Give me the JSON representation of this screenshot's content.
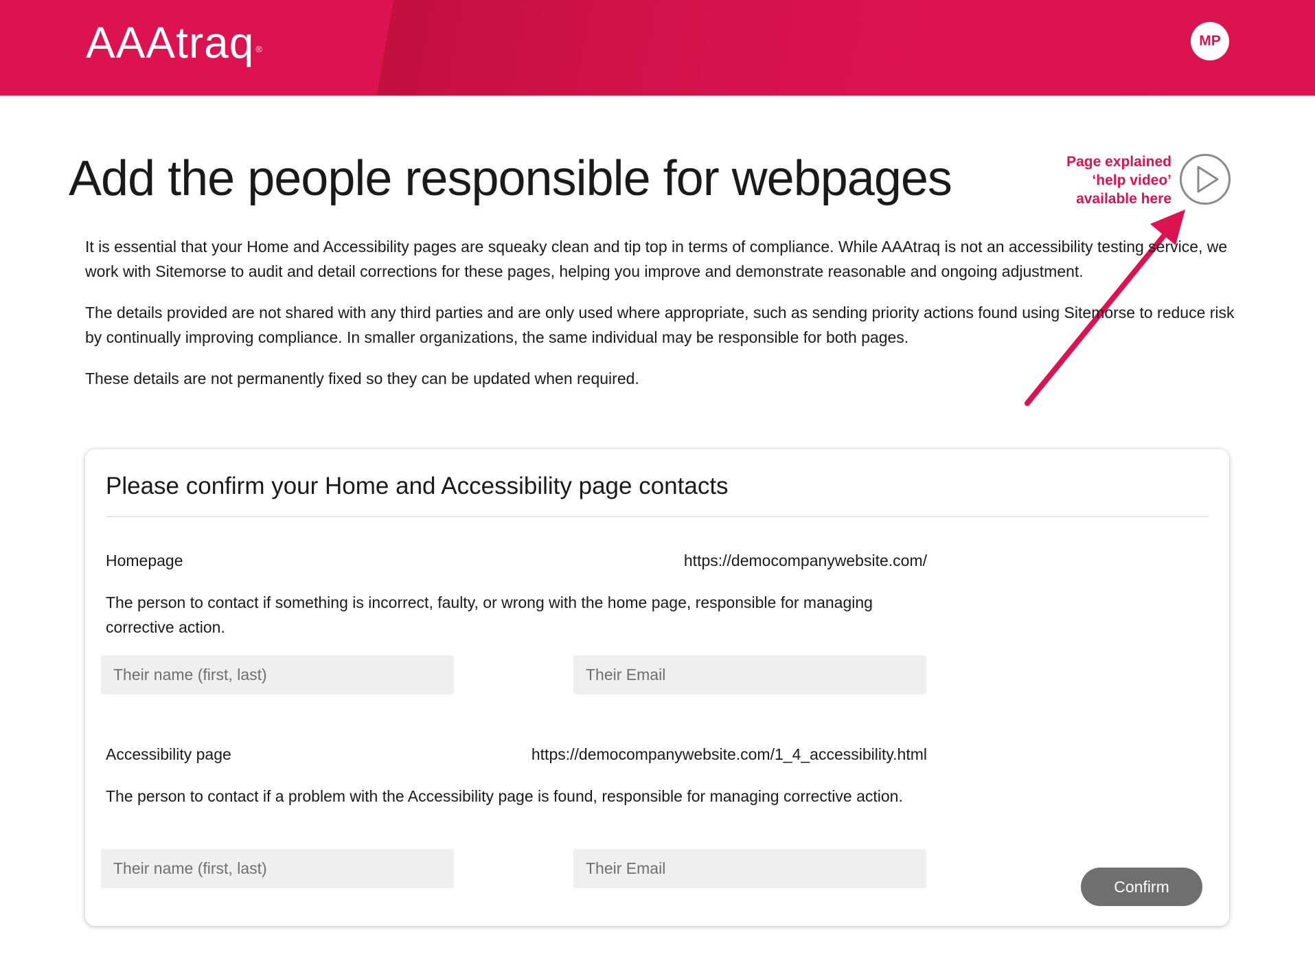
{
  "header": {
    "logo_text": "AAAtraq",
    "logo_mark": "®",
    "avatar_initials": "MP",
    "brand_color": "#dd1250"
  },
  "page": {
    "title": "Add the people responsible for webpages",
    "help_note_lines": [
      "Page explained",
      "‘help video’",
      "available here"
    ],
    "help_icon": "play-icon",
    "intro_paragraphs": [
      "It is essential that your Home and Accessibility pages are squeaky clean and tip top in terms of compliance. While AAAtraq is not an accessibility testing service, we work with Sitemorse to audit and detail corrections for these pages, helping you improve and demonstrate reasonable and ongoing adjustment.",
      "The details provided are not shared with any third parties and are only used where appropriate, such as sending priority actions found using Sitemorse to reduce risk by continually improving compliance. In smaller organizations, the same individual may be responsible for both pages.",
      "These details are not permanently fixed so they can be updated when required."
    ]
  },
  "card": {
    "title": "Please confirm your Home and Accessibility page contacts",
    "homepage": {
      "label": "Homepage",
      "url": "https://democompanywebsite.com/",
      "description": "The person to contact if something is incorrect, faulty, or wrong with the home page, responsible for managing corrective action.",
      "name_placeholder": "Their name (first, last)",
      "name_value": "",
      "email_placeholder": "Their Email",
      "email_value": ""
    },
    "accessibility": {
      "label": "Accessibility page",
      "url": "https://democompanywebsite.com/1_4_accessibility.html",
      "description": "The person to contact if a problem with the Accessibility page is found, responsible for managing corrective action.",
      "name_placeholder": "Their name (first, last)",
      "name_value": "",
      "email_placeholder": "Their Email",
      "email_value": ""
    },
    "confirm_label": "Confirm"
  }
}
